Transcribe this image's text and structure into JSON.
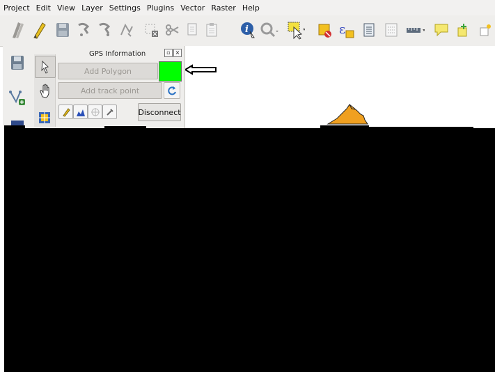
{
  "menubar": {
    "items": [
      {
        "label": "Project",
        "name": "menu-project"
      },
      {
        "label": "Edit",
        "name": "menu-edit"
      },
      {
        "label": "View",
        "name": "menu-view"
      },
      {
        "label": "Layer",
        "name": "menu-layer"
      },
      {
        "label": "Settings",
        "name": "menu-settings"
      },
      {
        "label": "Plugins",
        "name": "menu-plugins"
      },
      {
        "label": "Vector",
        "name": "menu-vector"
      },
      {
        "label": "Raster",
        "name": "menu-raster"
      },
      {
        "label": "Help",
        "name": "menu-help"
      }
    ]
  },
  "gps_panel": {
    "title": "GPS Information",
    "add_polygon_label": "Add Polygon",
    "add_track_point_label": "Add track point",
    "disconnect_label": "Disconnect",
    "feature_color": "#00ff00"
  },
  "colors": {
    "toolbar_bg": "#efeeec",
    "mountain": "#f0a020",
    "redacted": "#000000"
  },
  "icons": {
    "toolbar": [
      "edits-icon",
      "pencil-icon",
      "save-layer-icon",
      "add-feature-icon",
      "move-feature-icon",
      "node-tool-icon",
      "delete-selected-icon",
      "cut-icon",
      "copy-icon",
      "paste-icon",
      "identify-icon",
      "zoom-icon",
      "select-icon",
      "deselect-icon",
      "expression-icon",
      "attribute-table-icon",
      "field-calculator-icon",
      "measure-icon",
      "annotation-icon",
      "label-icon"
    ],
    "left": [
      "save-project-icon",
      "digitize-vertex-icon",
      "layer-icon"
    ]
  }
}
